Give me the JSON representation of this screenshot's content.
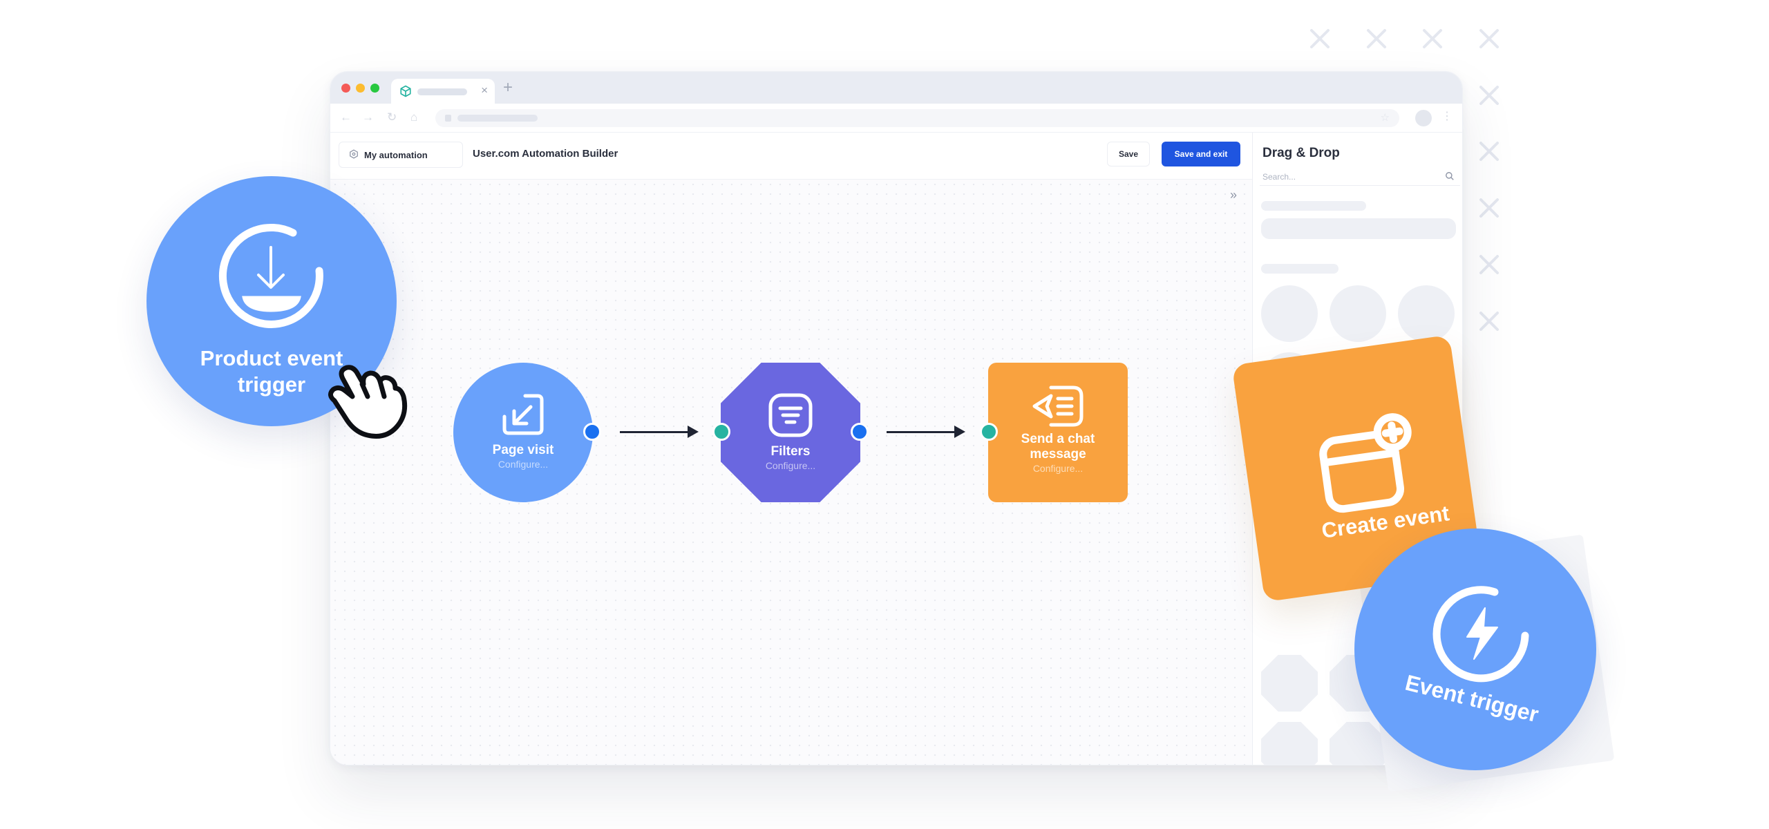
{
  "colors": {
    "accent_blue": "#1f55e0",
    "node_blue": "#69a1fb",
    "node_purple": "#6a67e0",
    "node_orange": "#f9a23f",
    "port_blue": "#1a70f0",
    "port_teal": "#26b3a1"
  },
  "browser": {
    "window_controls": [
      "close",
      "minimize",
      "maximize"
    ],
    "tab": {
      "icon": "cube-icon"
    }
  },
  "header": {
    "automation_name": "My automation",
    "title": "User.com Automation Builder",
    "save_label": "Save",
    "save_exit_label": "Save and exit"
  },
  "sidebar": {
    "title": "Drag & Drop",
    "search_placeholder": "Search..."
  },
  "flow": {
    "nodes": [
      {
        "title": "Page visit",
        "subtitle": "Configure...",
        "shape": "circle",
        "icon": "arrow-down-left-icon"
      },
      {
        "title": "Filters",
        "subtitle": "Configure...",
        "shape": "octagon",
        "icon": "filter-list-icon"
      },
      {
        "title": "Send a chat message",
        "subtitle": "Configure...",
        "shape": "rounded-square",
        "icon": "send-message-icon"
      }
    ]
  },
  "floating": {
    "product_event": "Product event trigger",
    "create_event": "Create event",
    "event_trigger": "Event trigger"
  }
}
